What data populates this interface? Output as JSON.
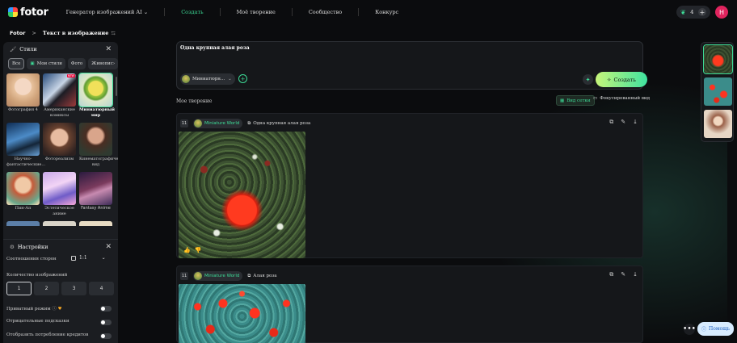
{
  "app": {
    "logo_text": "fotor",
    "nav": [
      {
        "label": "Генератор изображений AI"
      },
      {
        "label": "Создать"
      },
      {
        "label": "Моё творение"
      },
      {
        "label": "Сообщество"
      },
      {
        "label": "Конкурс"
      }
    ],
    "credits": "4",
    "avatar_letter": "H"
  },
  "breadcrumb": {
    "root": "Fotor",
    "sep": ">",
    "current": "Текст в изображение"
  },
  "styles_panel": {
    "title": "Стили",
    "chips": [
      "Все",
      "Мои стили",
      "Фото",
      "Живопис"
    ],
    "chip_more": "›",
    "tiles": [
      {
        "label": "Фотография 4",
        "new": false
      },
      {
        "label": "Американские комиксы",
        "new": true,
        "badge": "NEW"
      },
      {
        "label": "Миниатюрный мир",
        "selected": true
      },
      {
        "label": "Научно-фантастические...",
        "new": false
      },
      {
        "label": "Фотореализм",
        "new": false
      },
      {
        "label": "Кинематографический вид",
        "new": false
      },
      {
        "label": "Пин-Ап",
        "new": false
      },
      {
        "label": "Эстетическое аниме",
        "new": false
      },
      {
        "label": "Fantasy Anime",
        "new": false
      }
    ]
  },
  "settings": {
    "title": "Настройки",
    "aspect_label": "Соотношения сторон",
    "aspect_value": "1:1",
    "count_label": "Количество изображений",
    "counts": [
      "1",
      "2",
      "3",
      "4"
    ],
    "private_label": "Приватный режим",
    "negative_label": "Отрицательные подсказки",
    "credits_label": "Отобразить потребление кредитов"
  },
  "prompt": {
    "text": "Одна крупная алая роза",
    "style_pill": "Миниатюрн...",
    "create_label": "Создать"
  },
  "gallery": {
    "title": "Мое творение",
    "view_grid": "Вид сетки",
    "view_focus": "Фокусированный вид",
    "cards": [
      {
        "n": "11",
        "style": "Miniature World",
        "prompt": "Одна крупная алая роза"
      },
      {
        "n": "11",
        "style": "Miniature World",
        "prompt": "Алая роза"
      }
    ]
  },
  "help": {
    "label": "Помощь",
    "more": "•••"
  },
  "colors": {
    "accent": "#3ddc97",
    "background": "#0b0c0e",
    "panel": "#1b1d21",
    "avatar": "#e0245e"
  }
}
